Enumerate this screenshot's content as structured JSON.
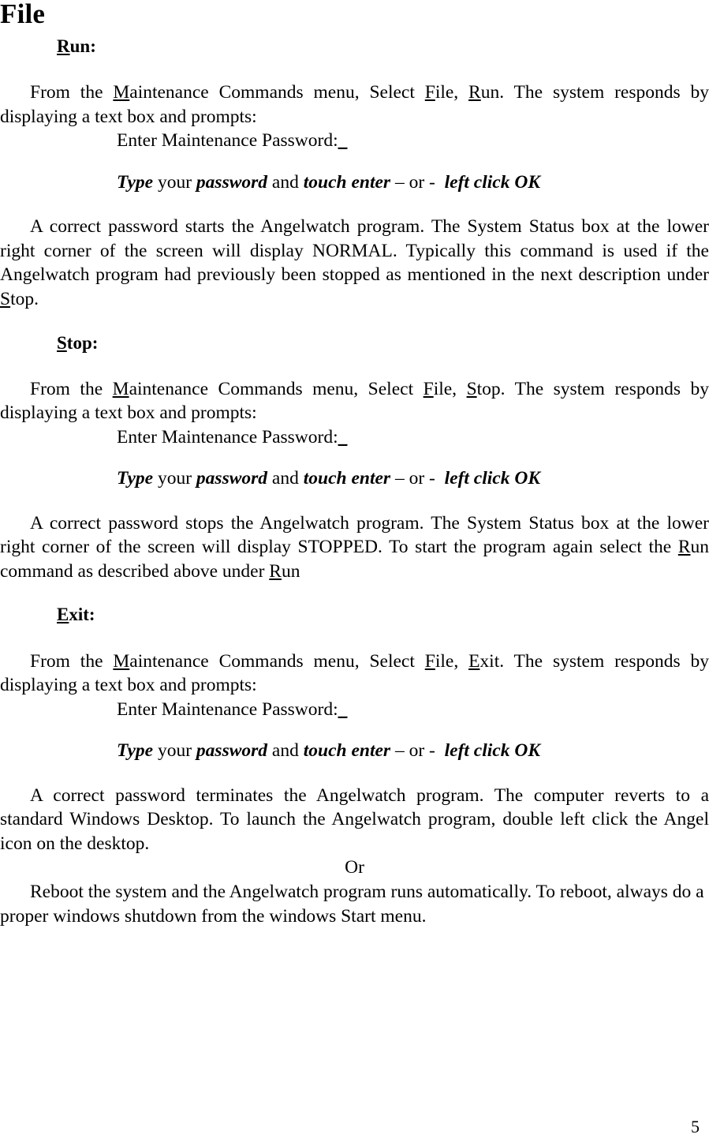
{
  "document": {
    "title": "File",
    "page_number": "5"
  },
  "sections": {
    "run": {
      "heading_mnemonic": "R",
      "heading_rest": "un:",
      "para_intro": {
        "t1": "From the ",
        "mn1": "M",
        "t2": "aintenance Commands menu, Select ",
        "mn2": "F",
        "t3": "ile, ",
        "mn3": "R",
        "t4": "un. The system responds by displaying a text box and prompts:"
      },
      "prompt": "Enter Maintenance Password:",
      "prompt_cursor": "_",
      "instruction": {
        "p1": "Type",
        "p2": " your ",
        "p3": "password",
        "p4": " and ",
        "p5": "touch enter",
        "p6": " – or -  ",
        "p7": "left click OK"
      },
      "para_result": {
        "t1": "A correct password starts the Angelwatch program. The System Status box at the lower right corner of the screen will display NORMAL. Typically this command is used if the Angelwatch program had previously been stopped as mentioned in the next description under ",
        "mn1": "S",
        "t2": "top."
      }
    },
    "stop": {
      "heading_mnemonic": "S",
      "heading_rest": "top:",
      "para_intro": {
        "t1": "From the ",
        "mn1": "M",
        "t2": "aintenance Commands menu, Select ",
        "mn2": "F",
        "t3": "ile, ",
        "mn3": "S",
        "t4": "top. The system responds by displaying a text box and prompts:"
      },
      "prompt": "Enter Maintenance Password:",
      "prompt_cursor": "_",
      "instruction": {
        "p1": "Type",
        "p2": " your ",
        "p3": "password",
        "p4": " and ",
        "p5": "touch enter",
        "p6": " – or -  ",
        "p7": "left click OK"
      },
      "para_result": {
        "t1": "A correct password stops the Angelwatch program. The System Status box at the lower right corner of the screen will display STOPPED. To start the program again select the ",
        "mn1": "R",
        "t2": "un command as described above under ",
        "mn2": "R",
        "t3": "un"
      }
    },
    "exit": {
      "heading_mnemonic": "E",
      "heading_rest": "xit:",
      "para_intro": {
        "t1": "From the ",
        "mn1": "M",
        "t2": "aintenance Commands menu, Select ",
        "mn2": "F",
        "t3": "ile, ",
        "mn3": "E",
        "t4": "xit. The system responds by displaying a text box and prompts:"
      },
      "prompt": "Enter Maintenance Password:",
      "prompt_cursor": "_",
      "instruction": {
        "p1": "Type",
        "p2": " your ",
        "p3": "password",
        "p4": " and ",
        "p5": "touch enter",
        "p6": " – or -  ",
        "p7": "left click OK"
      },
      "para_result": "A correct password terminates the Angelwatch program. The  computer reverts to a standard Windows Desktop. To launch the Angelwatch program, double left click the Angel icon on the desktop.",
      "or_label": "Or",
      "para_reboot": "Reboot the system and the Angelwatch program runs automatically. To reboot, always do a proper windows shutdown from the windows Start menu."
    }
  }
}
